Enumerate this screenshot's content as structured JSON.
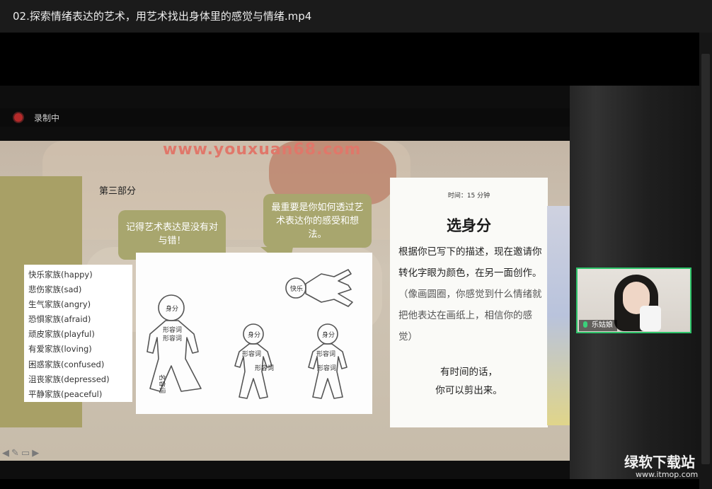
{
  "window": {
    "title": "02.探索情绪表达的艺术，用艺术找出身体里的感觉与情绪.mp4"
  },
  "recording": {
    "status_text": "录制中"
  },
  "slide": {
    "watermark": "www.youxuan68.com",
    "part_title": "第三部分",
    "bubble_left": "记得艺术表达是没有对与错！",
    "bubble_right": "最重要是你如何透过艺术表达你的感受和想法。",
    "families": [
      "快乐家族(happy)",
      "悲伤家族(sad)",
      "生气家族(angry)",
      "恐惧家族(afraid)",
      "顽皮家族(playful)",
      "有爱家族(loving)",
      "困惑家族(confused)",
      "沮丧家族(depressed)",
      "平静家族(peaceful)"
    ],
    "figures": [
      {
        "head": "身分",
        "labels": [
          "形容词",
          "形容词",
          "名容词"
        ]
      },
      {
        "head": "身分",
        "labels": [
          "形容词",
          "形容词"
        ]
      },
      {
        "head": "身分",
        "labels": [
          "形容词",
          "形容词"
        ]
      },
      {
        "head": "快乐",
        "labels": []
      }
    ],
    "time_label": "时间：15 分钟",
    "panel_title": "选身分",
    "panel_desc_main": "根据你已写下的描述，现在邀请你转化字眼为颜色，在另一面创作。",
    "panel_desc_sub": "（像画圆圈，你感觉到什么情绪就把他表达在画纸上，相信你的感觉）",
    "panel_foot_1": "有时间的话，",
    "panel_foot_2": "你可以剪出来。"
  },
  "participant": {
    "name": "乐姑娘"
  },
  "watermark_brand": {
    "name": "绿软下载站",
    "url": "www.itmop.com"
  },
  "icons": [
    "record-icon",
    "arrow-left-icon",
    "pen-icon",
    "screen-icon",
    "arrow-right-icon",
    "mic-icon"
  ]
}
